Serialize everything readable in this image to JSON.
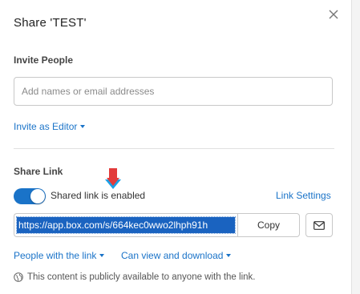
{
  "dialog": {
    "title": "Share 'TEST'",
    "close_icon": "close-icon"
  },
  "invite": {
    "section_label": "Invite People",
    "input_placeholder": "Add names or email addresses",
    "input_value": "",
    "role_label": "Invite as Editor"
  },
  "share_link": {
    "section_label": "Share Link",
    "toggle_on": true,
    "toggle_label": "Shared link is enabled",
    "settings_label": "Link Settings",
    "url": "https://app.box.com/s/664kec0wwo2lhph91h",
    "copy_label": "Copy",
    "email_icon": "envelope-icon",
    "access_label": "People with the link",
    "permission_label": "Can view and download",
    "notice": "This content is publicly available to anyone with the link."
  },
  "colors": {
    "accent": "#1a73c8",
    "selection": "#1a63c0",
    "annotation_arrow_head": "#e23b3b",
    "annotation_arrow_body": "#1aa0e6"
  }
}
